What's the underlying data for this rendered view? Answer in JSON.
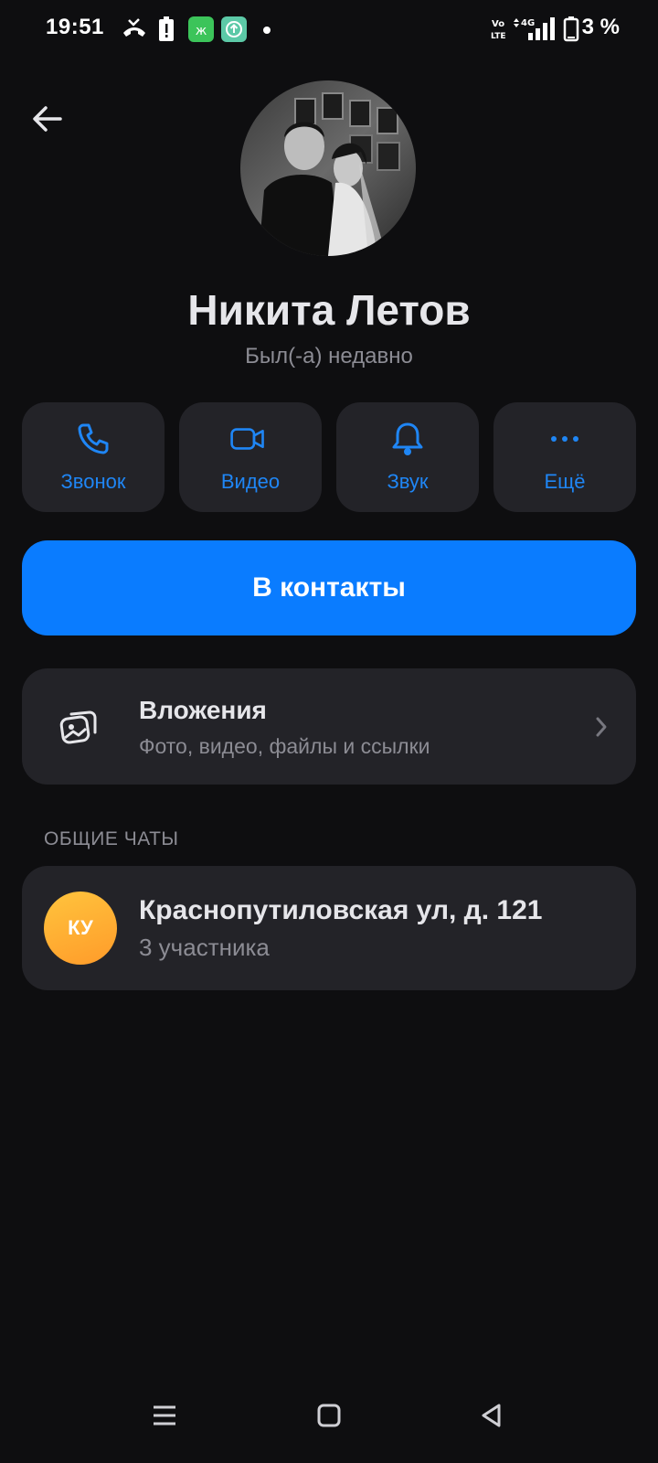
{
  "status_bar": {
    "time": "19:51",
    "battery_text": "3 %",
    "icons": [
      "missed-call-icon",
      "battery-alert-icon",
      "app-notification-icon",
      "upload-icon",
      "volte-icon",
      "4g-icon",
      "signal-icon",
      "battery-icon"
    ]
  },
  "profile": {
    "name": "Никита Летов",
    "last_seen": "Был(-а) недавно"
  },
  "actions": [
    {
      "label": "Звонок",
      "icon": "phone-icon"
    },
    {
      "label": "Видео",
      "icon": "video-icon"
    },
    {
      "label": "Звук",
      "icon": "bell-icon"
    },
    {
      "label": "Ещё",
      "icon": "more-icon"
    }
  ],
  "add_contact_label": "В контакты",
  "attachments": {
    "title": "Вложения",
    "subtitle": "Фото, видео, файлы и ссылки"
  },
  "shared_chats": {
    "section_title": "ОБЩИЕ ЧАТЫ",
    "items": [
      {
        "initials": "КУ",
        "title": "Краснопутиловская ул, д. 121",
        "subtitle": "3 участника"
      }
    ]
  },
  "colors": {
    "background": "#0e0e10",
    "card": "#232328",
    "accent": "#0a7cff",
    "accent_text": "#1f86f5"
  }
}
